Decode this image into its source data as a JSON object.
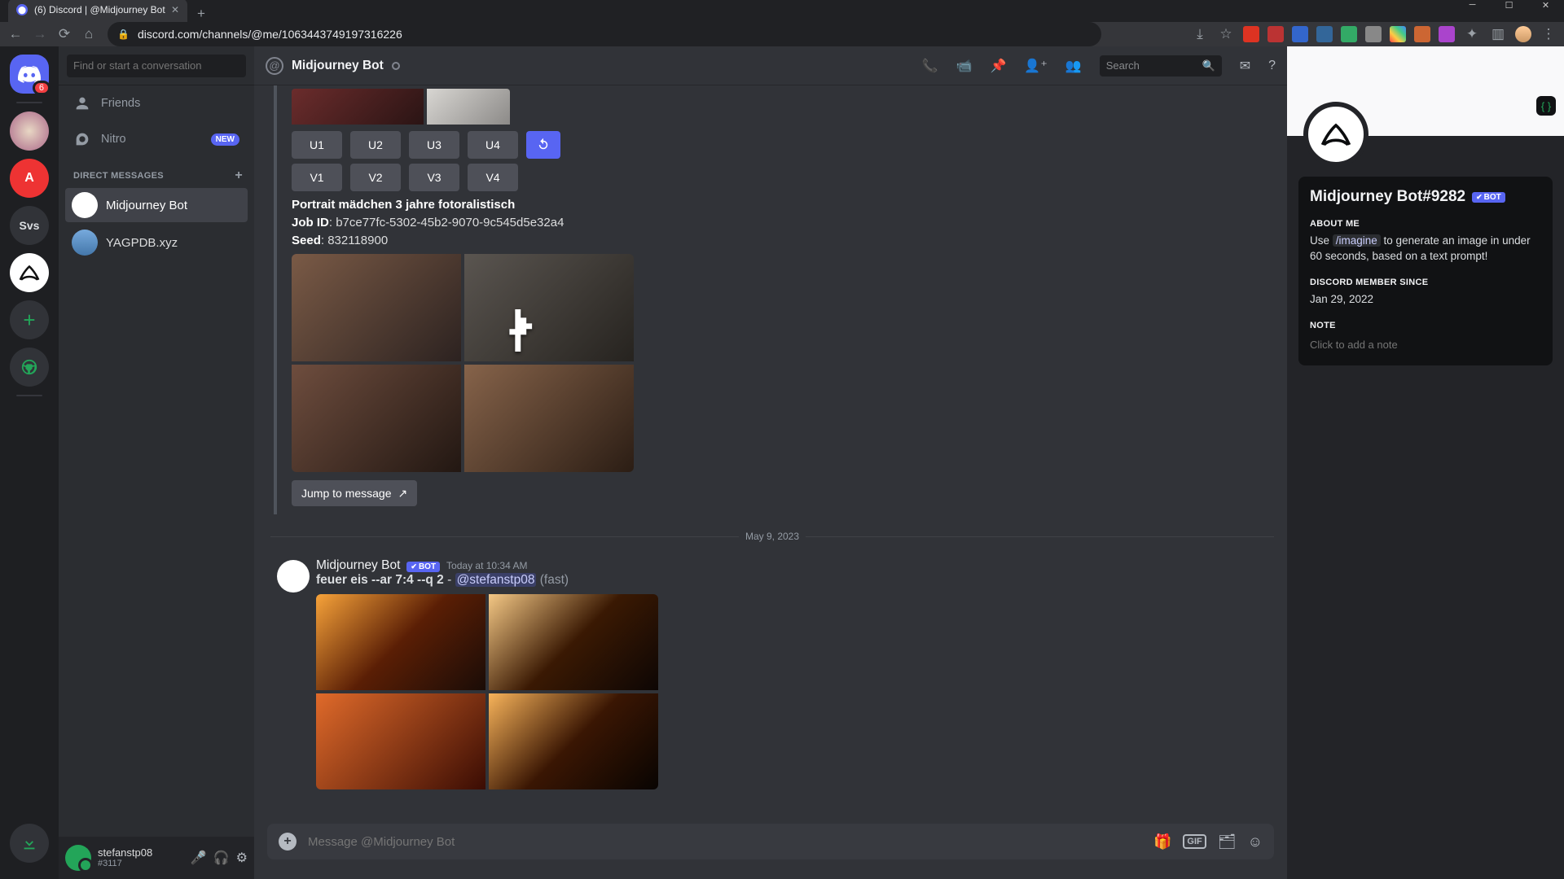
{
  "browser": {
    "tab_title": "(6) Discord | @Midjourney Bot",
    "url": "discord.com/channels/@me/1063443749197316226"
  },
  "rail": {
    "svs": "Svs",
    "home_badge": "6"
  },
  "dm": {
    "search_placeholder": "Find or start a conversation",
    "friends": "Friends",
    "nitro": "Nitro",
    "nitro_new": "NEW",
    "section": "DIRECT MESSAGES",
    "contacts": [
      {
        "name": "Midjourney Bot"
      },
      {
        "name": "YAGPDB.xyz"
      }
    ]
  },
  "user": {
    "name": "stefanstp08",
    "tag": "#3117"
  },
  "header": {
    "title": "Midjourney Bot",
    "search_placeholder": "Search"
  },
  "reply": {
    "u": [
      "U1",
      "U2",
      "U3",
      "U4"
    ],
    "v": [
      "V1",
      "V2",
      "V3",
      "V4"
    ],
    "title": "Portrait mädchen 3 jahre fotoralistisch",
    "jobid_label": "Job ID",
    "jobid": "b7ce77fc-5302-45b2-9070-9c545d5e32a4",
    "seed_label": "Seed",
    "seed": "832118900",
    "jump": "Jump to message"
  },
  "divider_date": "May 9, 2023",
  "msg": {
    "author": "Midjourney Bot",
    "bot": "BOT",
    "time": "Today at 10:34 AM",
    "prompt_a": "feuer eis --ar 7:4 --q 2",
    "dash": " - ",
    "mention": "@stefanstp08",
    "fast": " (fast)"
  },
  "composer": {
    "placeholder": "Message @Midjourney Bot"
  },
  "profile": {
    "name": "Midjourney Bot#9282",
    "bot": "BOT",
    "h_about": "ABOUT ME",
    "about_a": "Use ",
    "about_cmd": "/imagine",
    "about_b": " to generate an image in under 60 seconds, based on a text prompt!",
    "h_member": "DISCORD MEMBER SINCE",
    "member": "Jan 29, 2022",
    "h_note": "NOTE",
    "note_placeholder": "Click to add a note"
  }
}
